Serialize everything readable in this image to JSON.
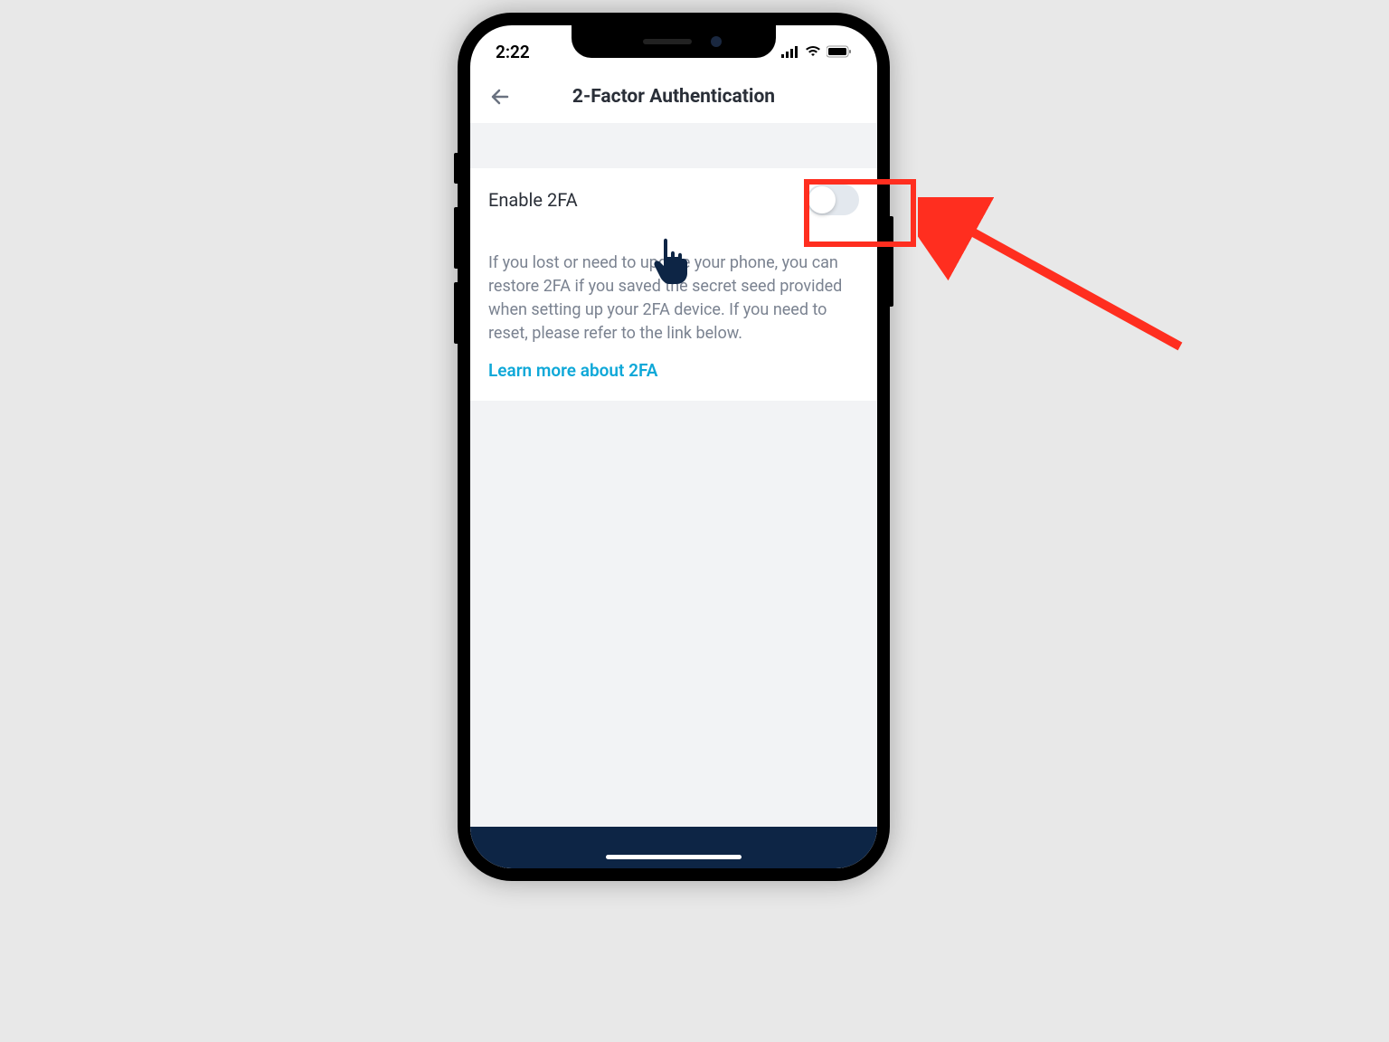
{
  "status_bar": {
    "time": "2:22"
  },
  "header": {
    "title": "2-Factor Authentication"
  },
  "toggle": {
    "label": "Enable 2FA"
  },
  "description": {
    "text": "If you lost or need to update your phone, you can restore 2FA if you saved the secret seed provided when setting up your 2FA device. If you need to reset, please refer to the link below.",
    "link_text": "Learn more about 2FA"
  }
}
